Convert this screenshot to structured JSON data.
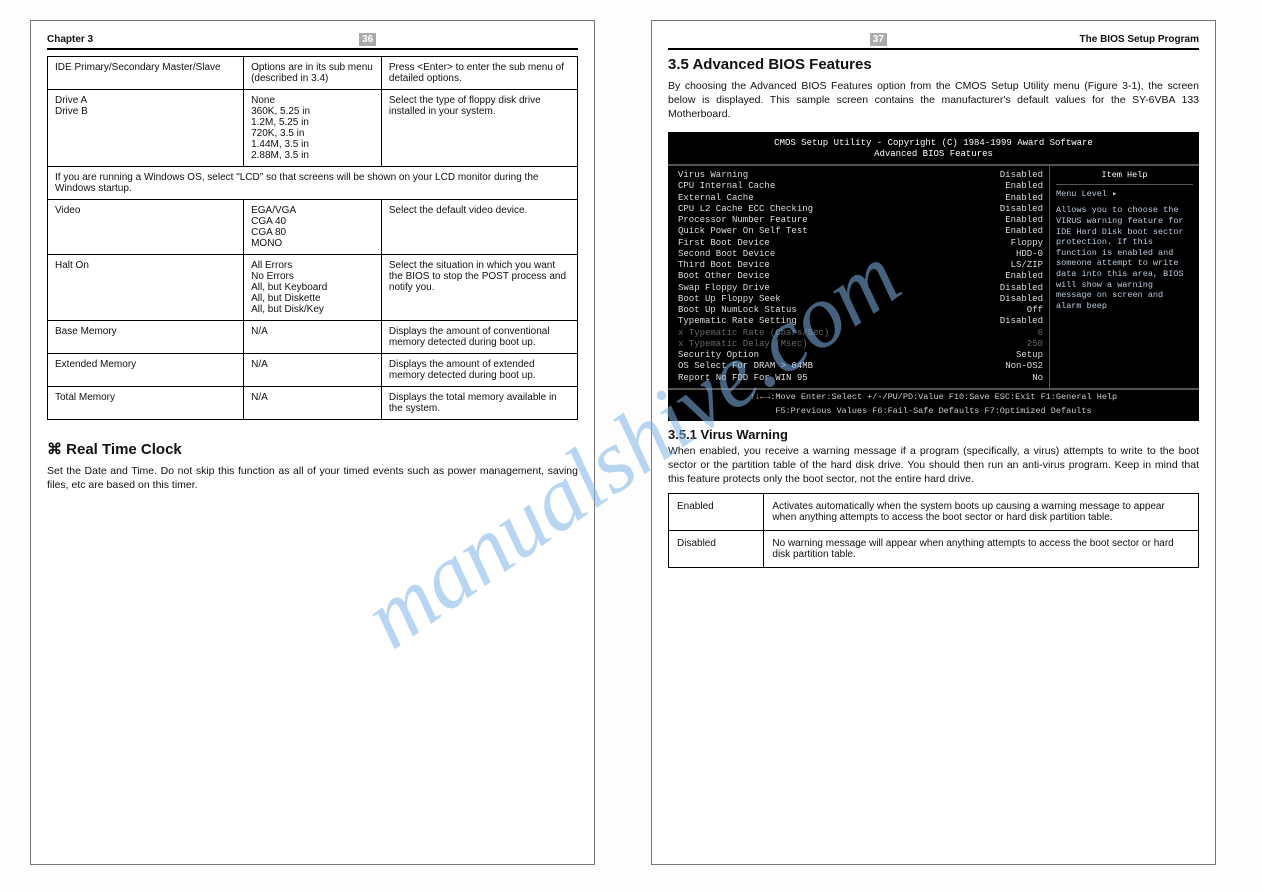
{
  "watermark": "manualshive.com",
  "left_page": {
    "header_title": "Chapter 3",
    "header_pagenum": "36",
    "hw_rows": [
      {
        "label": "IDE Primary/Secondary Master/Slave",
        "val": "Options are in its sub menu (described in 3.4)",
        "desc": "Press <Enter> to enter the sub menu of detailed options."
      },
      {
        "label": "Drive A\nDrive B",
        "val": "None\n360K, 5.25 in\n1.2M, 5.25 in\n720K, 3.5 in\n1.44M, 3.5 in\n2.88M, 3.5 in",
        "desc": "Select the type of floppy disk drive installed in your system."
      },
      {
        "label_span": "If you are running a Windows OS, select \"LCD\" so that screens will be shown on your LCD monitor during the Windows startup."
      },
      {
        "label": "Video",
        "val": "EGA/VGA\nCGA 40\nCGA 80\nMONO",
        "desc": "Select the default video device."
      },
      {
        "label": "Halt On",
        "val": "All Errors\nNo Errors\nAll, but Keyboard\nAll, but Diskette\nAll, but Disk/Key",
        "desc": "Select the situation in which you want the BIOS to stop the POST process and notify you."
      },
      {
        "label": "Base Memory",
        "val": "N/A",
        "desc": "Displays the amount of conventional memory detected during boot up."
      },
      {
        "label": "Extended Memory",
        "val": "N/A",
        "desc": "Displays the amount of extended memory detected during boot up."
      },
      {
        "label": "Total Memory",
        "val": "N/A",
        "desc": "Displays the total memory available in the system."
      }
    ],
    "rt_title": "⌘ Real Time Clock",
    "rt_body": "Set the Date and Time. Do not skip this function as all of your timed events such as power management, saving files, etc are based on this timer.",
    "footer_left": "",
    "footer_right": ""
  },
  "right_page": {
    "header_pagenum": "37",
    "header_title_right": "The BIOS Setup Program",
    "bios_heading": "3.5 Advanced BIOS Features",
    "bios_intro": "By choosing the Advanced BIOS Features option from the CMOS Setup Utility menu (Figure 3-1), the screen below is displayed. This sample screen contains the manufacturer's default values for the SY-6VBA 133 Motherboard.",
    "screenshot": {
      "title1": "CMOS Setup Utility - Copyright (C) 1984-1999 Award Software",
      "title2": "Advanced BIOS Features",
      "items": [
        {
          "name": "Virus Warning",
          "val": "Disabled",
          "dim": false
        },
        {
          "name": "CPU Internal Cache",
          "val": "Enabled",
          "dim": false
        },
        {
          "name": "External Cache",
          "val": "Enabled",
          "dim": false
        },
        {
          "name": "CPU L2 Cache ECC Checking",
          "val": "Disabled",
          "dim": false
        },
        {
          "name": "Processor Number Feature",
          "val": "Enabled",
          "dim": false
        },
        {
          "name": "Quick Power On Self Test",
          "val": "Enabled",
          "dim": false
        },
        {
          "name": "First Boot Device",
          "val": "Floppy",
          "dim": false
        },
        {
          "name": "Second Boot Device",
          "val": "HDD-0",
          "dim": false
        },
        {
          "name": "Third Boot Device",
          "val": "LS/ZIP",
          "dim": false
        },
        {
          "name": "Boot Other Device",
          "val": "Enabled",
          "dim": false
        },
        {
          "name": "Swap Floppy Drive",
          "val": "Disabled",
          "dim": false
        },
        {
          "name": "Boot Up Floppy Seek",
          "val": "Disabled",
          "dim": false
        },
        {
          "name": "Boot Up NumLock Status",
          "val": "Off",
          "dim": false
        },
        {
          "name": "Typematic Rate Setting",
          "val": "Disabled",
          "dim": false
        },
        {
          "name": "x Typematic Rate (Chars/Sec)",
          "val": "6",
          "dim": true
        },
        {
          "name": "x Typematic Delay (Msec)",
          "val": "250",
          "dim": true
        },
        {
          "name": "Security Option",
          "val": "Setup",
          "dim": false
        },
        {
          "name": "OS Select For DRAM > 64MB",
          "val": "Non-OS2",
          "dim": false
        },
        {
          "name": "Report No FDD For WIN 95",
          "val": "No",
          "dim": false
        }
      ],
      "help_title": "Item Help",
      "help_menu": "Menu Level      ▸",
      "help_body": "Allows you to choose the VIRUS warning feature for IDE Hard Disk boot sector protection. If this function is enabled and someone attempt to write data into this area, BIOS will show a warning message on screen and alarm beep",
      "foot1": "↑↓←→:Move  Enter:Select  +/-/PU/PD:Value  F10:Save  ESC:Exit  F1:General Help",
      "foot2": "F5:Previous Values   F6:Fail-Safe Defaults   F7:Optimized Defaults"
    },
    "sub_heading": "3.5.1 Virus Warning",
    "sub_text": "When enabled, you receive a warning message if a program (specifically, a virus) attempts to write to the boot sector or the partition table of the hard disk drive.\nYou should then run an anti-virus program. Keep in mind that this feature protects only the boot sector, not the entire hard drive.",
    "opt_rows": [
      {
        "opt": "Enabled",
        "desc": "Activates automatically when the system boots up causing a warning message to appear when anything attempts to access the boot sector or hard disk partition table."
      },
      {
        "opt": "Disabled",
        "desc": "No warning message will appear when anything attempts to access the boot sector or hard disk partition table."
      }
    ],
    "footer_left": "",
    "footer_right": ""
  }
}
